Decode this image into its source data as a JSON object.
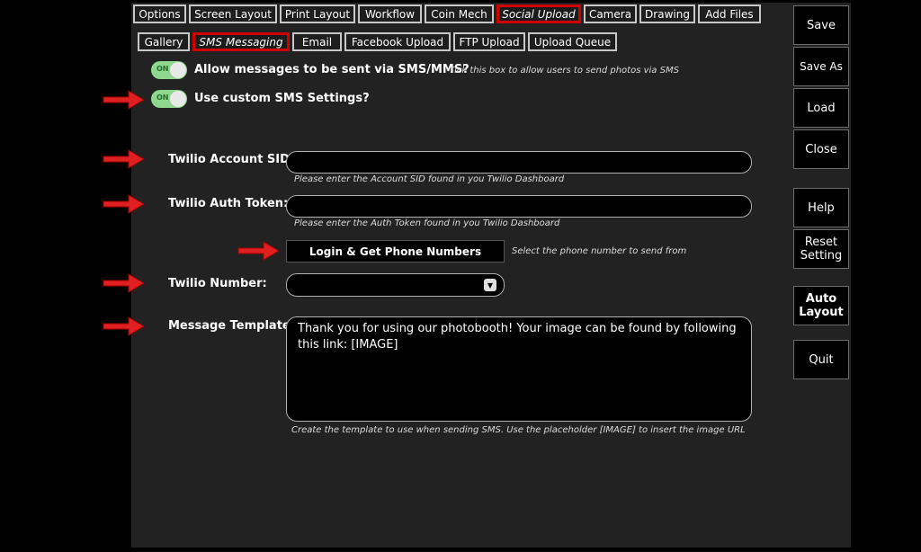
{
  "top_tabs": [
    "Options",
    "Screen Layout",
    "Print Layout",
    "Workflow",
    "Coin Mech",
    "Social Upload",
    "Camera",
    "Drawing",
    "Add Files"
  ],
  "sub_tabs": [
    "Gallery",
    "SMS Messaging",
    "Email",
    "Facebook Upload",
    "FTP Upload",
    "Upload Queue"
  ],
  "sms": {
    "allow_toggle_text": "ON",
    "allow_label": "Allow messages to be sent via SMS/MMS?",
    "allow_hint": "Tick this box to allow users to send photos via SMS",
    "custom_toggle_text": "ON",
    "custom_label": "Use custom SMS Settings?",
    "sid_label": "Twilio Account SID:",
    "sid_value": "",
    "sid_hint": "Please enter the Account SID found in you Twilio Dashboard",
    "token_label": "Twilio Auth Token:",
    "token_value": "",
    "token_hint": "Please enter the Auth Token found in you Twilio Dashboard",
    "login_button": "Login & Get Phone Numbers",
    "login_hint": "Select the phone number to send from",
    "number_label": "Twilio Number:",
    "number_value": "",
    "template_label": "Message Template:",
    "template_value": "Thank you for using our photobooth! Your image can be found by following this link: [IMAGE]",
    "template_hint": "Create the template to use when sending SMS. Use the placeholder [IMAGE] to insert the image URL"
  },
  "sidebar": {
    "save": "Save",
    "save_as": "Save As",
    "load": "Load",
    "close": "Close",
    "help": "Help",
    "reset_line1": "Reset",
    "reset_line2": "Setting",
    "auto_line1": "Auto",
    "auto_line2": "Layout",
    "quit": "Quit"
  },
  "colors": {
    "active_tab_border": "#d00000",
    "toggle_on": "#8fd68f",
    "arrow_red": "#e02020"
  }
}
